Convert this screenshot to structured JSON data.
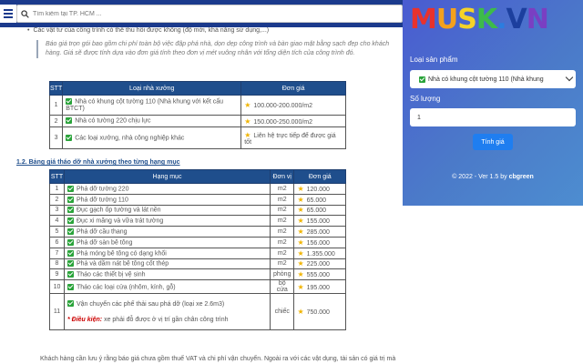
{
  "search": {
    "placeholder": "Tìm kiếm tại TP. HCM ..."
  },
  "article": {
    "bullet": "Các vật tư của công trình có thể thu hồi được không (độ mới, khả năng sử dụng,...)",
    "quote": "Báo giá trọn gói bao gồm chi phí toàn bộ việc đập phá nhà, dọn dẹp công trình và bàn giao mặt bằng sạch đẹp cho khách hàng. Giá sẽ được tính dựa vào đơn giá tính theo đơn vị mét vuông nhân với tổng diện tích của công trình đó.",
    "table1": {
      "headers": [
        "STT",
        "Loại nhà xưởng",
        "Đơn giá"
      ],
      "rows": [
        {
          "stt": "1",
          "name": "Nhà có khung cột tường 110 (Nhà khung với kết cấu BTCT)",
          "price": "100.000-200.000/m2"
        },
        {
          "stt": "2",
          "name": "Nhà có tường 220 chịu lực",
          "price": "150.000-250.000/m2"
        },
        {
          "stt": "3",
          "name": "Các loại xưởng, nhà công nghiệp khác",
          "price": "Liên hệ trực tiếp để được giá tốt"
        }
      ]
    },
    "heading2": "1.2. Bảng giá tháo dỡ nhà xưởng theo từng hạng mục",
    "table2": {
      "headers": [
        "STT",
        "Hạng mục",
        "Đơn vị",
        "Đơn giá"
      ],
      "rows": [
        {
          "stt": "1",
          "item": "Phá dỡ tường 220",
          "unit": "m2",
          "price": "120.000"
        },
        {
          "stt": "2",
          "item": "Phá dỡ tường 110",
          "unit": "m2",
          "price": "65.000"
        },
        {
          "stt": "3",
          "item": "Đục gạch ốp tường và lát nền",
          "unit": "m2",
          "price": "65.000"
        },
        {
          "stt": "4",
          "item": "Đục xi măng và vữa trát tường",
          "unit": "m2",
          "price": "155.000"
        },
        {
          "stt": "5",
          "item": "Phá dỡ cầu thang",
          "unit": "m2",
          "price": "285.000"
        },
        {
          "stt": "6",
          "item": "Phá dỡ sàn bê tông",
          "unit": "m2",
          "price": "156.000"
        },
        {
          "stt": "7",
          "item": "Phá móng bê tông có dạng khối",
          "unit": "m2",
          "price": "1.355.000"
        },
        {
          "stt": "8",
          "item": "Phá và dầm nát bê tông cốt thép",
          "unit": "m2",
          "price": "225.000"
        },
        {
          "stt": "9",
          "item": "Tháo các thiết bị vệ sinh",
          "unit": "phòng",
          "price": "555.000"
        },
        {
          "stt": "10",
          "item": "Tháo các loại cửa (nhôm, kính, gỗ)",
          "unit": "bộ cửa",
          "price": "195.000"
        },
        {
          "stt": "11",
          "item": "Vận chuyển các phế thải sau phá dỡ (loại xe 2.6m3)",
          "warn_label": "* Điều kiện:",
          "warn_text": " xe phải đỗ được ở vị trí gần chân công trình",
          "unit": "chiếc",
          "price": "750.000"
        }
      ]
    },
    "footer_note": "Khách hàng cần lưu ý rằng báo giá chưa gồm thuế VAT và chi phí vận chuyển. Ngoài ra với các vật dụng, tài sản có giá trị mà"
  },
  "panel": {
    "logo": [
      {
        "ch": "M",
        "color": "#e8322d"
      },
      {
        "ch": "U",
        "color": "#f4a11d"
      },
      {
        "ch": "S",
        "color": "#f5d328"
      },
      {
        "ch": "K",
        "color": "#3dbb4a"
      },
      {
        "ch": ".",
        "color": "#2b7de0"
      },
      {
        "ch": "V",
        "color": "#1c3f9e"
      },
      {
        "ch": "N",
        "color": "#7a3fc2"
      }
    ],
    "type_label": "Loại sản phẩm",
    "type_value": "Nhà có khung cột tường 110 (Nhà khung",
    "qty_label": "Số lượng",
    "qty_value": "1",
    "calc_label": "Tính giá",
    "copyright_prefix": "© 2022 - Ver 1.5 by ",
    "copyright_author": "cbgreen",
    "colors": {
      "accent": "#1f7ef0",
      "header": "#1b3a8c",
      "table_header": "#1f4e8c"
    }
  }
}
